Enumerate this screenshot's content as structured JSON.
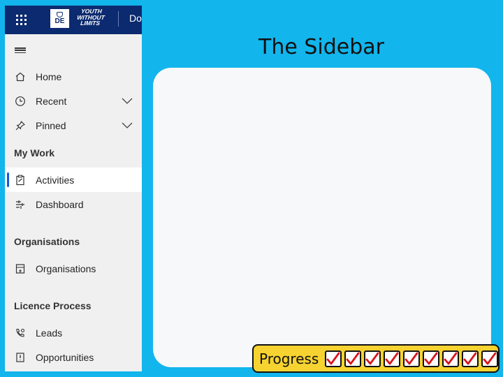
{
  "topbar": {
    "logo_de": "DE",
    "logo_ywl": [
      "YOUTH",
      "WITHOUT",
      "LIMITS"
    ],
    "app_name": "Do"
  },
  "nav": {
    "items": [
      {
        "label": "Home",
        "icon": "home-icon"
      },
      {
        "label": "Recent",
        "icon": "clock-icon",
        "expandable": true
      },
      {
        "label": "Pinned",
        "icon": "pin-icon",
        "expandable": true
      }
    ],
    "my_work": {
      "heading": "My Work",
      "items": [
        {
          "label": "Activities",
          "icon": "clipboard-icon",
          "active": true
        },
        {
          "label": "Dashboard",
          "icon": "dashboard-icon"
        }
      ]
    },
    "organisations": {
      "heading": "Organisations",
      "items": [
        {
          "label": "Organisations",
          "icon": "organisation-icon"
        }
      ]
    },
    "licence": {
      "heading": "Licence Process",
      "items": [
        {
          "label": "Leads",
          "icon": "phone-gear-icon"
        },
        {
          "label": "Opportunities",
          "icon": "opportunity-icon"
        }
      ]
    }
  },
  "main": {
    "title": "The Sidebar"
  },
  "progress": {
    "label": "Progress",
    "checked": 9,
    "total": 9
  },
  "colors": {
    "background": "#12b5ec",
    "topbar": "#0b2a6f",
    "active_indicator": "#1a56d6",
    "progress_bg": "#f6d330",
    "check": "#d9141b"
  }
}
